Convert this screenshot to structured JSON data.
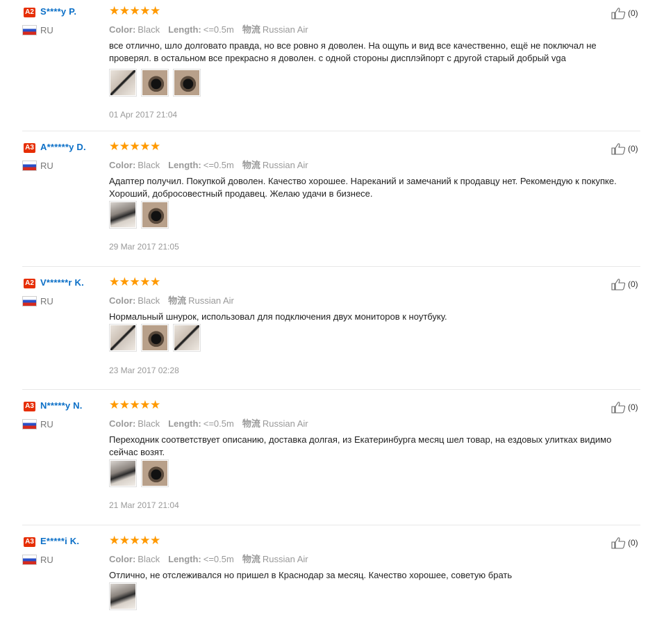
{
  "labels": {
    "color": "Color:",
    "length": "Length:",
    "shipping_icon": "物流"
  },
  "reviews": [
    {
      "level": "A2",
      "user": "S****y P.",
      "country": "RU",
      "color_value": "Black",
      "length_value": "<=0.5m",
      "shipping": "Russian Air",
      "text": "все отлично, шло долговато правда, но все ровно я доволен. На ощупь и вид все качественно, ещё не поключал не проверял. в остальном все прекрасно я доволен. с одной стороны дисплэйпорт с другой старый добрый vga",
      "date": "01 Apr 2017 21:04",
      "likes": "(0)",
      "rating": 5,
      "photos": [
        "cable-photo",
        "adapter-photo",
        "adapter-photo"
      ]
    },
    {
      "level": "A3",
      "user": "A******y D.",
      "country": "RU",
      "color_value": "Black",
      "length_value": "<=0.5m",
      "shipping": "Russian Air",
      "text": "Адаптер получил. Покупкой доволен. Качество хорошее. Нареканий и замечаний к продавцу нет. Рекомендую к покупке. Хороший, добросовестный продавец. Желаю удачи в бизнесе.",
      "date": "29 Mar 2017 21:05",
      "likes": "(0)",
      "rating": 5,
      "photos": [
        "package-photo",
        "adapter-photo"
      ]
    },
    {
      "level": "A2",
      "user": "V******r K.",
      "country": "RU",
      "color_value": "Black",
      "length_value": "",
      "shipping": "Russian Air",
      "text": "Нормальный шнурок, использовал для подключения двух мониторов к ноутбуку.",
      "date": "23 Mar 2017 02:28",
      "likes": "(0)",
      "rating": 5,
      "photos": [
        "cable-photo",
        "adapter-photo",
        "cable-photo"
      ]
    },
    {
      "level": "A3",
      "user": "N*****y N.",
      "country": "RU",
      "color_value": "Black",
      "length_value": "<=0.5m",
      "shipping": "Russian Air",
      "text": "Переходник соответствует описанию, доставка долгая, из Екатеринбурга месяц шел товар, на ездовых улитках видимо сейчас возят.",
      "date": "21 Mar 2017 21:04",
      "likes": "(0)",
      "rating": 5,
      "photos": [
        "package-photo",
        "adapter-photo"
      ]
    },
    {
      "level": "A3",
      "user": "E*****i K.",
      "country": "RU",
      "color_value": "Black",
      "length_value": "<=0.5m",
      "shipping": "Russian Air",
      "text": "Отлично, не отслеживался но пришел в Краснодар за месяц. Качество хорошее, советую брать",
      "date": "",
      "likes": "(0)",
      "rating": 5,
      "photos": [
        "package-photo"
      ]
    }
  ]
}
